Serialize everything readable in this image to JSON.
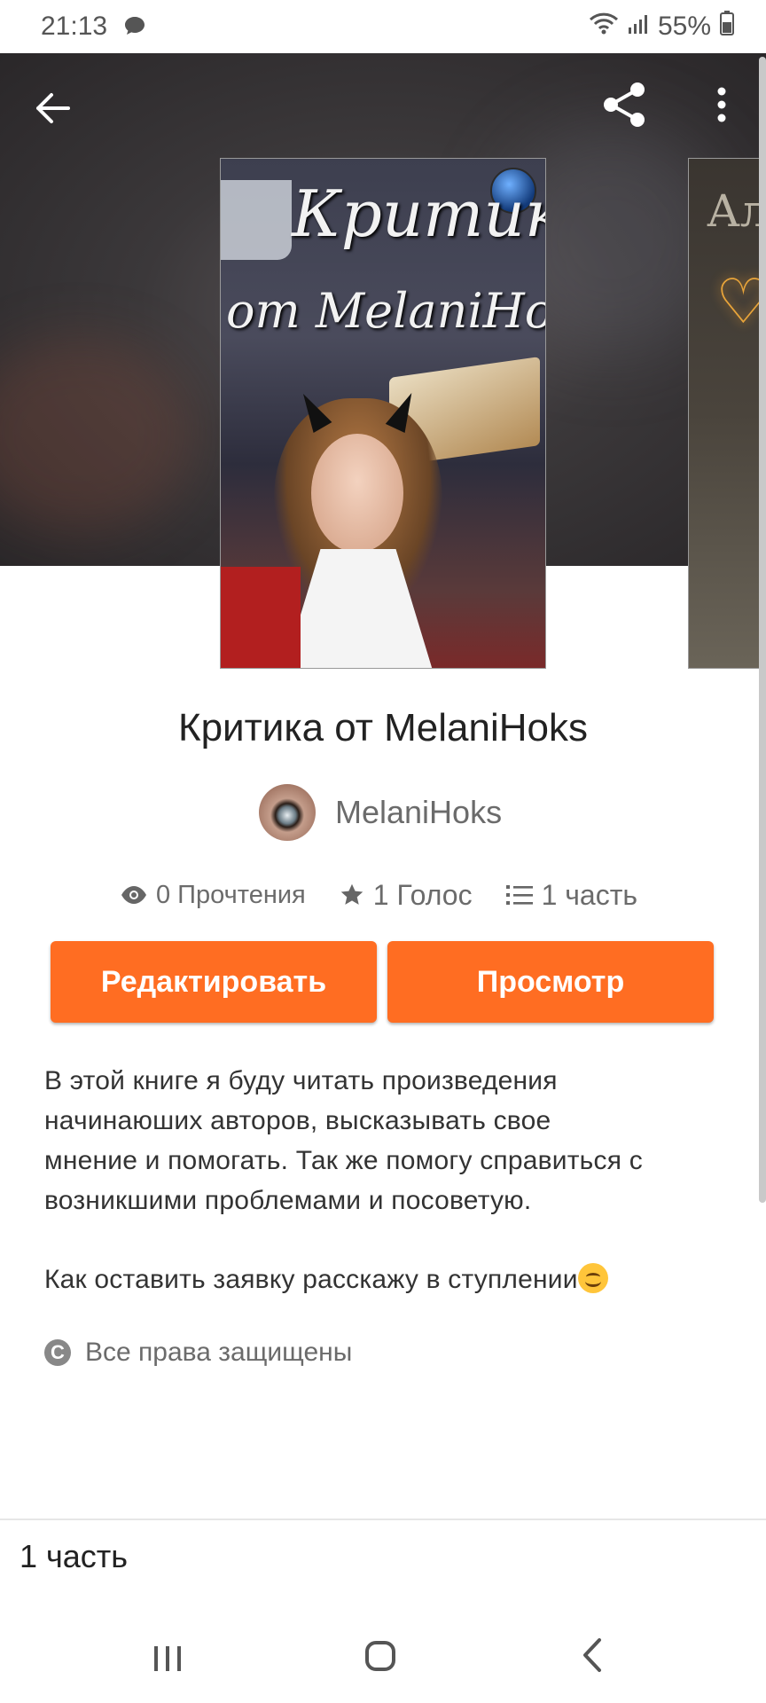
{
  "status_bar": {
    "time": "21:13",
    "battery": "55%"
  },
  "cover": {
    "title_line1": "Критика",
    "title_line2": "от MelaniHoks",
    "next_cover_text": "Ал"
  },
  "story": {
    "title": "Критика от MelaniHoks",
    "author": "MelaniHoks",
    "reads": "0 Прочтения",
    "votes": "1 Голос",
    "parts": "1 часть"
  },
  "buttons": {
    "edit": "Редактировать",
    "preview": "Просмотр"
  },
  "description": {
    "paragraph1_line1": "В этой книге я буду читать произведения",
    "paragraph1_line2": "начинаюших авторов, высказывать свое",
    "paragraph1_line3": "мнение и помогать. Так же помогу справиться с",
    "paragraph1_line4": "возникшими проблемами и посоветую.",
    "paragraph2": "Как оставить заявку расскажу в ступлении"
  },
  "copyright": {
    "icon_letter": "C",
    "text": "Все права защищены"
  },
  "footer": {
    "parts_label": "1 часть"
  },
  "colors": {
    "accent": "#ff6d22",
    "hero_bg": "#3b383a"
  },
  "icons": {
    "back": "arrow-left-icon",
    "share": "share-icon",
    "more": "more-vertical-icon",
    "reads": "eye-icon",
    "votes": "star-icon",
    "parts": "list-icon",
    "copyright": "copyright-icon"
  }
}
